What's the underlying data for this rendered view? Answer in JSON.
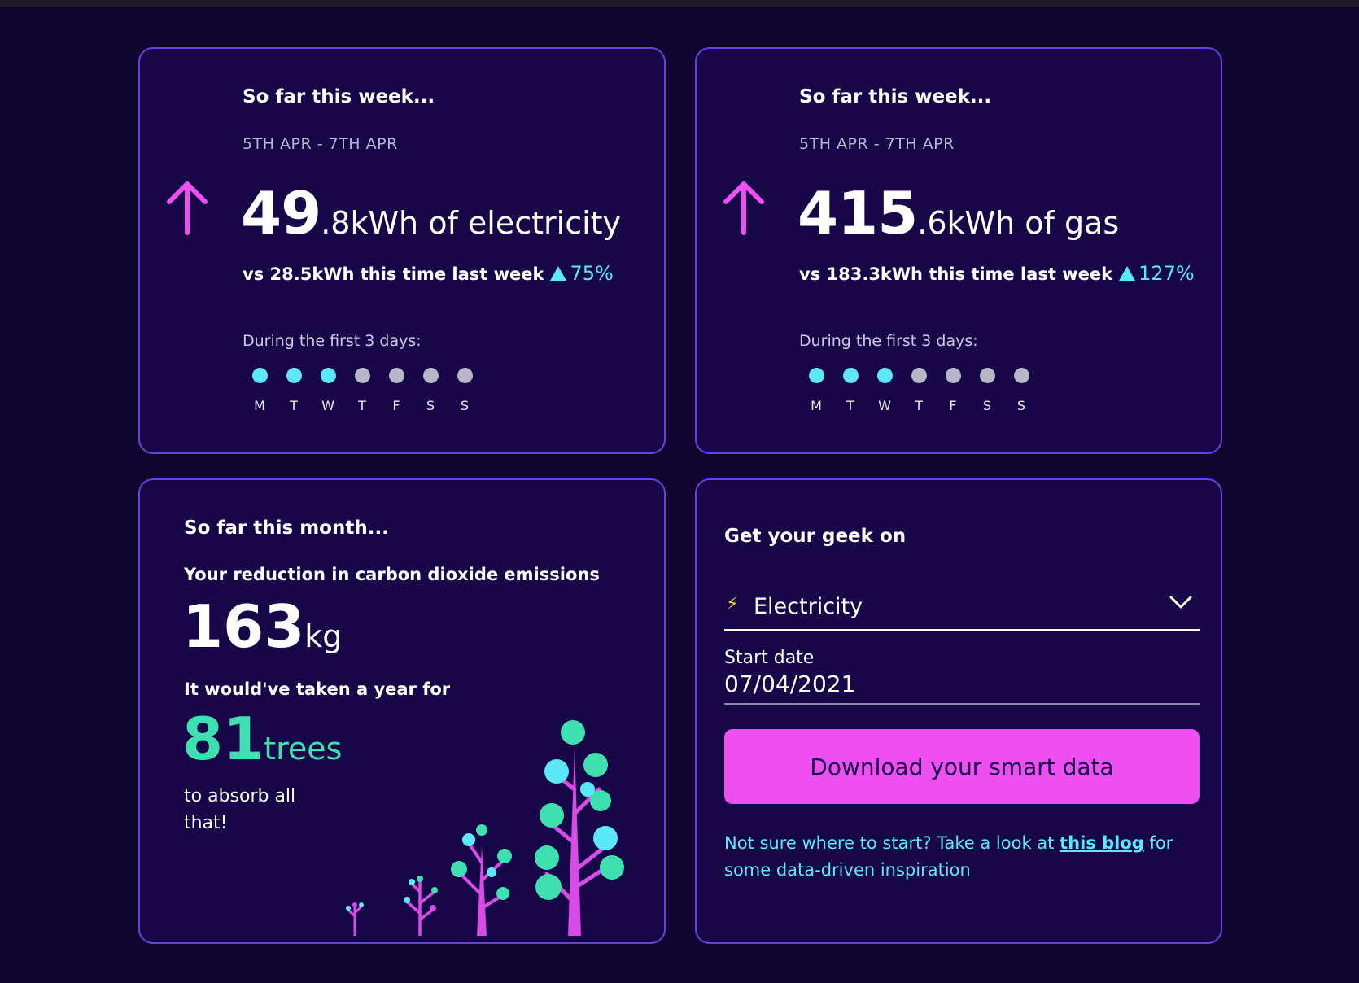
{
  "electricity_card": {
    "title": "So far this week...",
    "date_range": "5TH APR - 7TH APR",
    "value_int": "49",
    "value_rest": ".8kWh of electricity",
    "vs_text": "vs 28.5kWh this time last week",
    "change_pct": "75%",
    "first_days_label": "During the first 3 days:",
    "days": [
      {
        "letter": "M",
        "active": true
      },
      {
        "letter": "T",
        "active": true
      },
      {
        "letter": "W",
        "active": true
      },
      {
        "letter": "T",
        "active": false
      },
      {
        "letter": "F",
        "active": false
      },
      {
        "letter": "S",
        "active": false
      },
      {
        "letter": "S",
        "active": false
      }
    ]
  },
  "gas_card": {
    "title": "So far this week...",
    "date_range": "5TH APR - 7TH APR",
    "value_int": "415",
    "value_rest": ".6kWh of gas",
    "vs_text": "vs 183.3kWh this time last week",
    "change_pct": "127%",
    "first_days_label": "During the first 3 days:",
    "days": [
      {
        "letter": "M",
        "active": true
      },
      {
        "letter": "T",
        "active": true
      },
      {
        "letter": "W",
        "active": true
      },
      {
        "letter": "T",
        "active": false
      },
      {
        "letter": "F",
        "active": false
      },
      {
        "letter": "S",
        "active": false
      },
      {
        "letter": "S",
        "active": false
      }
    ]
  },
  "carbon_card": {
    "title": "So far this month...",
    "reduction_label": "Your reduction in carbon dioxide emissions",
    "co2_value": "163",
    "co2_unit": "kg",
    "year_for_label": "It would've taken a year for",
    "trees_value": "81",
    "trees_unit": "trees",
    "absorb_line1": "to absorb all",
    "absorb_line2": "that!"
  },
  "geek_card": {
    "title": "Get your geek on",
    "fuel_select_value": "Electricity",
    "start_date_label": "Start date",
    "start_date_value": "07/04/2021",
    "download_label": "Download your smart data",
    "help_prefix": "Not sure where to start? Take a look at ",
    "help_link": "this blog",
    "help_suffix": " for some data-driven inspiration"
  },
  "colors": {
    "background": "#0f0630",
    "card": "#170748",
    "border": "#6a3fe0",
    "accent_pink": "#ee4ff0",
    "accent_cyan": "#5ce8f8",
    "accent_green": "#3ee0b0"
  },
  "icons": [
    "arrow-up-icon",
    "triangle-up-icon",
    "lightning-icon",
    "chevron-down-icon"
  ]
}
